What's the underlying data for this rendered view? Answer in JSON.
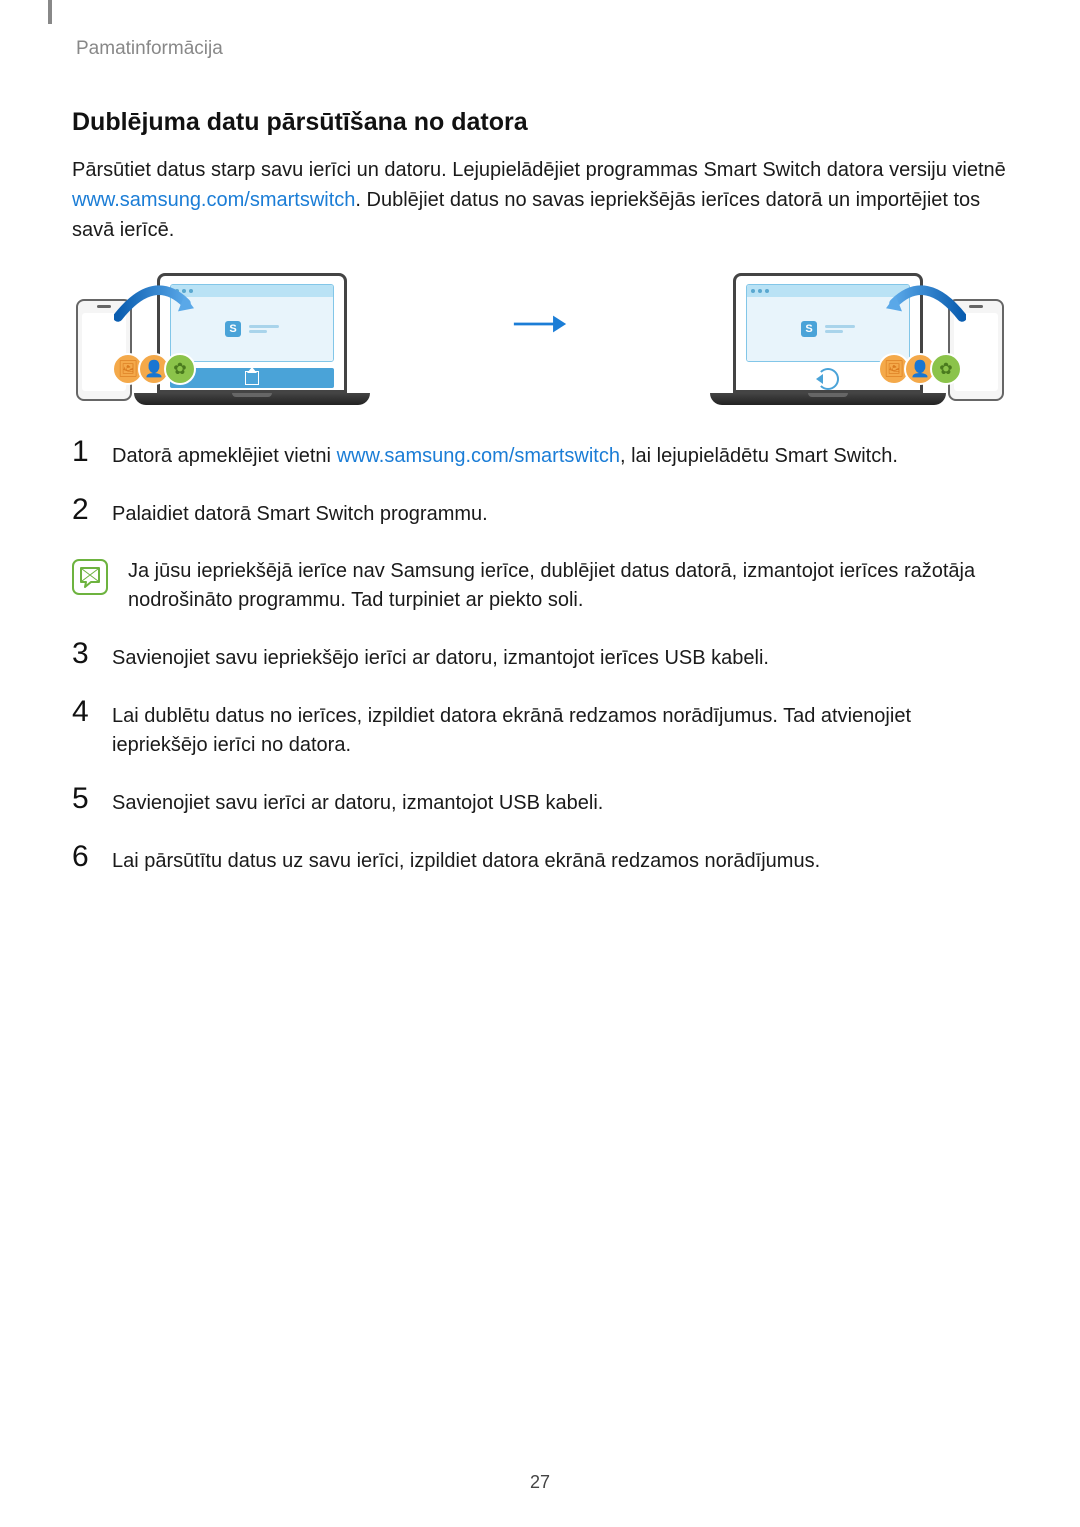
{
  "header": {
    "section_label": "Pamatinformācija"
  },
  "title": "Dublējuma datu pārsūtīšana no datora",
  "intro": {
    "pre": "Pārsūtiet datus starp savu ierīci un datoru. Lejupielādējiet programmas Smart Switch datora versiju vietnē ",
    "link": "www.samsung.com/smartswitch",
    "post": ". Dublējiet datus no savas iepriekšējās ierīces datorā un importējiet tos savā ierīcē."
  },
  "steps": {
    "s1": {
      "num": "1",
      "pre": "Datorā apmeklējiet vietni ",
      "link": "www.samsung.com/smartswitch",
      "post": ", lai lejupielādētu Smart Switch."
    },
    "s2": {
      "num": "2",
      "text": "Palaidiet datorā Smart Switch programmu."
    },
    "s3": {
      "num": "3",
      "text": "Savienojiet savu iepriekšējo ierīci ar datoru, izmantojot ierīces USB kabeli."
    },
    "s4": {
      "num": "4",
      "text": "Lai dublētu datus no ierīces, izpildiet datora ekrānā redzamos norādījumus. Tad atvienojiet iepriekšējo ierīci no datora."
    },
    "s5": {
      "num": "5",
      "text": "Savienojiet savu ierīci ar datoru, izmantojot USB kabeli."
    },
    "s6": {
      "num": "6",
      "text": "Lai pārsūtītu datus uz savu ierīci, izpildiet datora ekrānā redzamos norādījumus."
    }
  },
  "note": "Ja jūsu iepriekšējā ierīce nav Samsung ierīce, dublējiet datus datorā, izmantojot ierīces ražotāja nodrošināto programmu. Tad turpiniet ar piekto soli.",
  "icons": {
    "s_label": "S",
    "badge_image": "🖼",
    "badge_person": "👤",
    "badge_gear": "✿"
  },
  "page_number": "27"
}
